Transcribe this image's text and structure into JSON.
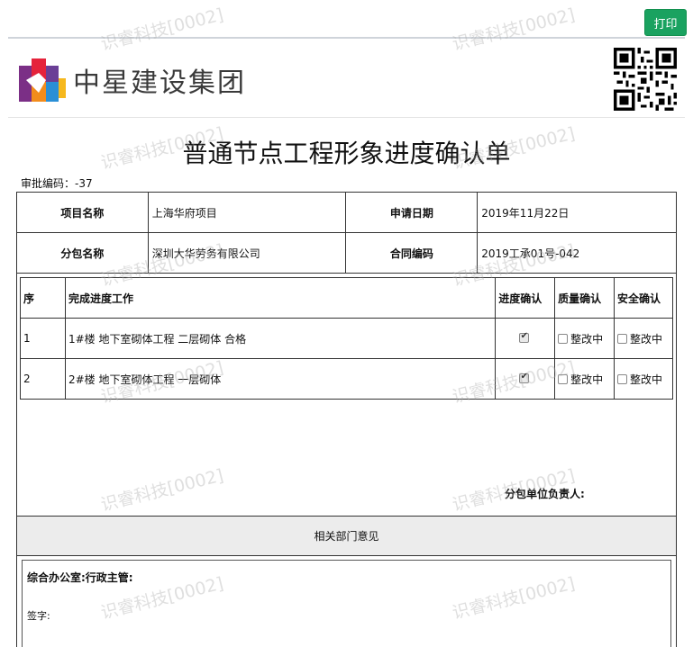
{
  "toolbar": {
    "print_label": "打印"
  },
  "header": {
    "company_name": "中星建设集团",
    "logo_icon": "company-logo-icon",
    "qr_icon": "qr-code-icon"
  },
  "document": {
    "title": "普通节点工程形象进度确认单",
    "approval_label": "审批编码：",
    "approval_code": "-37"
  },
  "info": {
    "project_label": "项目名称",
    "project_value": "上海华府项目",
    "date_label": "申请日期",
    "date_value": "2019年11月22日",
    "subcontract_label": "分包名称",
    "subcontract_value": "深圳大华劳务有限公司",
    "contract_label": "合同编码",
    "contract_value": "2019工承01号-042"
  },
  "work": {
    "headers": [
      "序",
      "完成进度工作",
      "进度确认",
      "质量确认",
      "安全确认"
    ],
    "rows": [
      {
        "no": "1",
        "desc": "1#楼 地下室砌体工程 二层砌体 合格",
        "progress_checked": true,
        "quality_label": "整改中",
        "safety_label": "整改中"
      },
      {
        "no": "2",
        "desc": "2#楼 地下室砌体工程 一层砌体",
        "progress_checked": true,
        "quality_label": "整改中",
        "safety_label": "整改中"
      }
    ],
    "sign_label": "分包单位负责人:"
  },
  "departments": {
    "bar_label": "相关部门意见",
    "office_title": "综合办公室:行政主管:",
    "sign_label": "签字:"
  },
  "watermark": "识睿科技[0002]",
  "colors": {
    "print_button": "#1aa260",
    "dept_bar": "#ececec"
  }
}
